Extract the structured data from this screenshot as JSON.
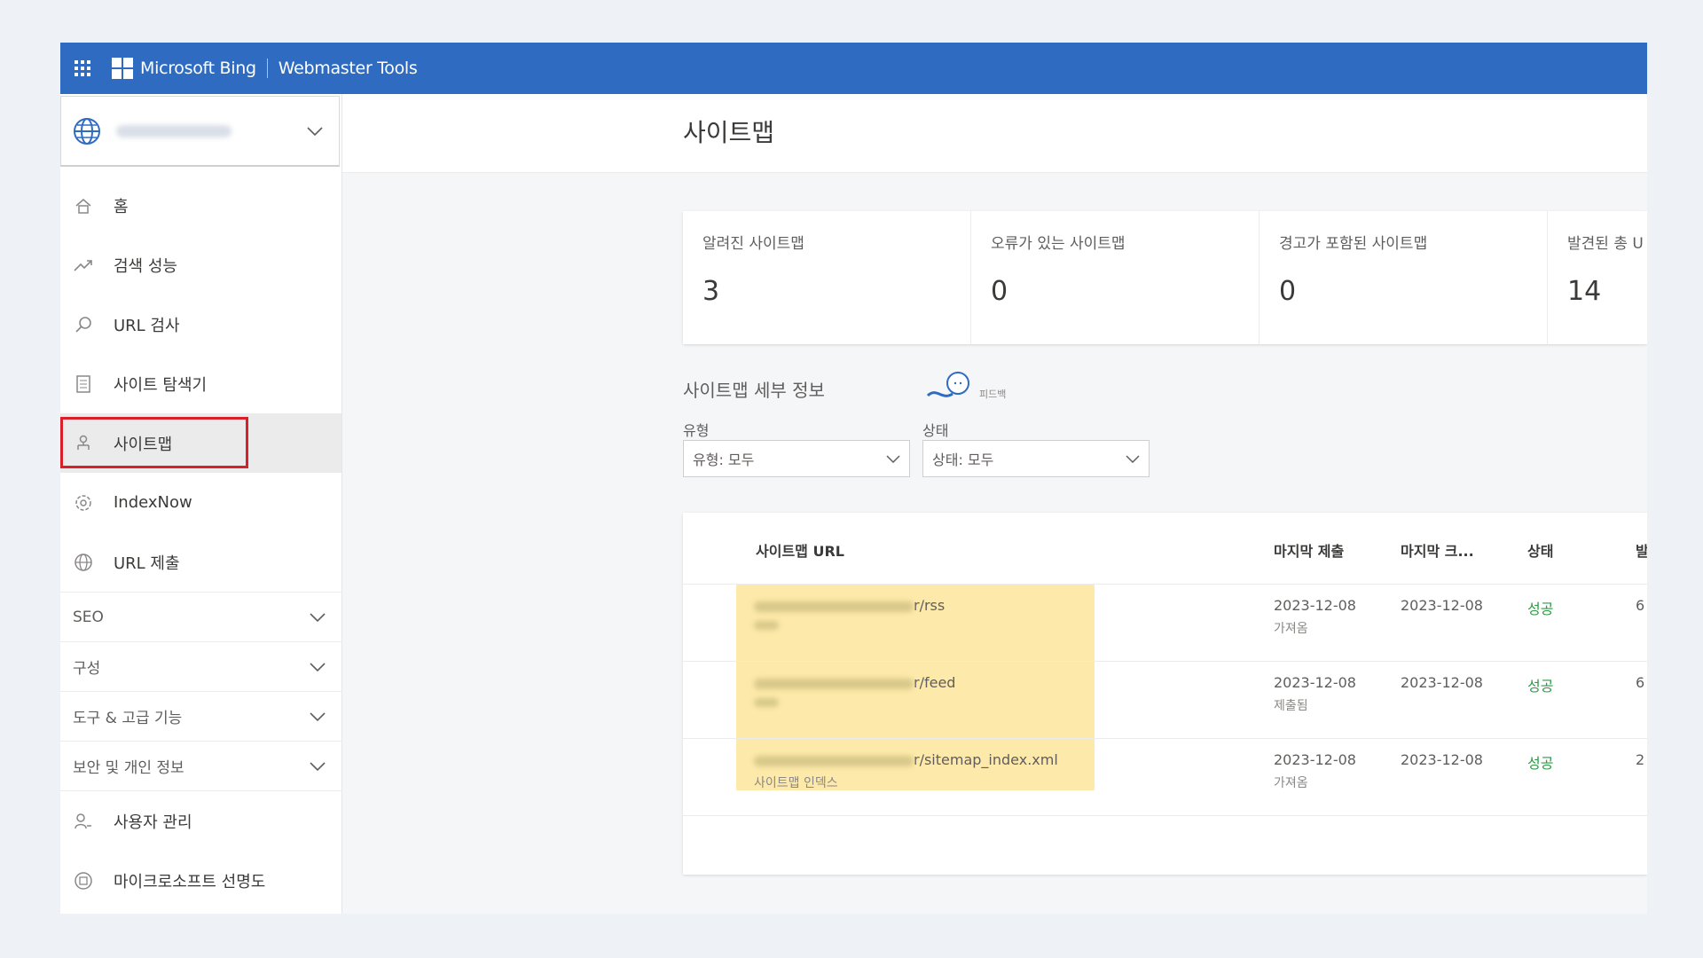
{
  "topbar": {
    "brand": "Microsoft Bing",
    "product": "Webmaster Tools"
  },
  "sidebar": {
    "items": [
      {
        "label": "홈",
        "icon": "home-icon"
      },
      {
        "label": "검색 성능",
        "icon": "trend-icon"
      },
      {
        "label": "URL 검사",
        "icon": "search-icon"
      },
      {
        "label": "사이트 탐색기",
        "icon": "document-icon"
      },
      {
        "label": "사이트맵",
        "icon": "sitemap-icon",
        "active": true
      },
      {
        "label": "IndexNow",
        "icon": "gear-icon"
      },
      {
        "label": "URL 제출",
        "icon": "globe-icon"
      }
    ],
    "groups": [
      "SEO",
      "구성",
      "도구 & 고급 기능",
      "보안 및 개인 정보"
    ],
    "bottom_items": [
      {
        "label": "사용자 관리",
        "icon": "users-icon"
      },
      {
        "label": "마이크로소프트 선명도",
        "icon": "clarity-icon"
      }
    ]
  },
  "main": {
    "title": "사이트맵",
    "stats": [
      {
        "label": "알려진 사이트맵",
        "value": "3"
      },
      {
        "label": "오류가 있는 사이트맵",
        "value": "0"
      },
      {
        "label": "경고가 포함된 사이트맵",
        "value": "0"
      },
      {
        "label": "발견된 총 U",
        "value": "14"
      }
    ],
    "section_title": "사이트맵 세부 정보",
    "feedback_label": "피드백",
    "filters": {
      "type_label": "유형",
      "type_value": "유형: 모두",
      "status_label": "상태",
      "status_value": "상태: 모두"
    },
    "table": {
      "headers": [
        "사이트맵 URL",
        "마지막 제출",
        "마지막 크...",
        "상태",
        "발"
      ],
      "rows": [
        {
          "url_suffix": "r/rss",
          "last_submitted": "2023-12-08",
          "submitted_by": "가져옴",
          "last_crawled": "2023-12-08",
          "status": "성공",
          "count": "6"
        },
        {
          "url_suffix": "r/feed",
          "last_submitted": "2023-12-08",
          "submitted_by": "제출됨",
          "last_crawled": "2023-12-08",
          "status": "성공",
          "count": "6"
        },
        {
          "url_suffix": "r/sitemap_index.xml",
          "url_type": "사이트맵 인덱스",
          "last_submitted": "2023-12-08",
          "submitted_by": "가져옴",
          "last_crawled": "2023-12-08",
          "status": "성공",
          "count": "2"
        }
      ]
    }
  },
  "colors": {
    "topbar": "#2f6cc1",
    "highlight_box": "#d9202a",
    "url_highlight": "#fde9a9",
    "success": "#2e9a46"
  }
}
